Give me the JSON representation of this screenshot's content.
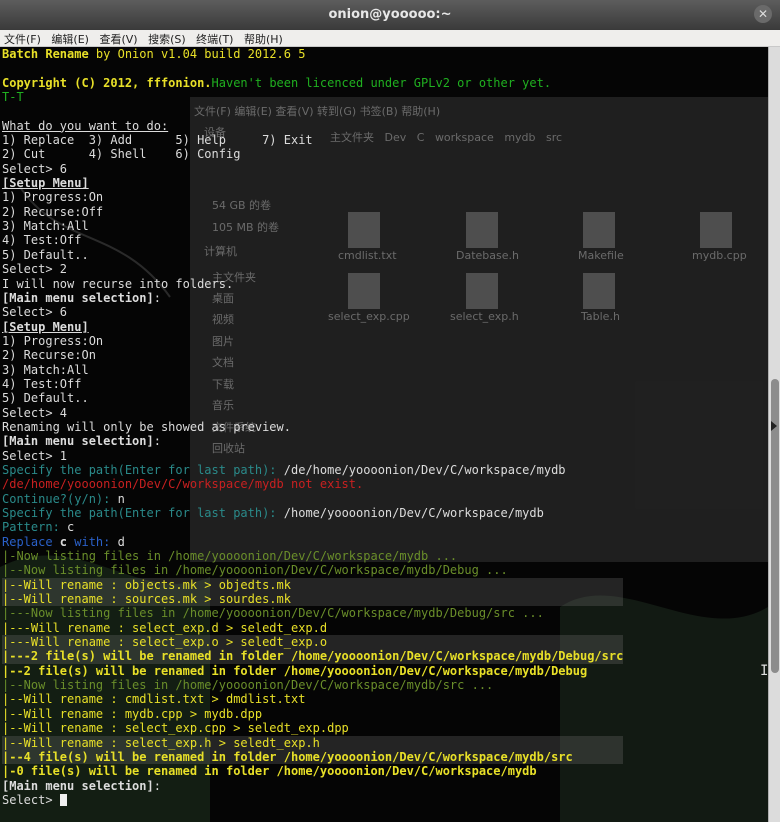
{
  "window": {
    "title": "onion@yooooo:~"
  },
  "menu": [
    "文件(F)",
    "编辑(E)",
    "查看(V)",
    "搜索(S)",
    "终端(T)",
    "帮助(H)"
  ],
  "background_window": {
    "menu": "文件(F)  编辑(E)  查看(V)  转到(G)  书签(B)  帮助(H)",
    "places": [
      "设备",
      "54 GB 的卷",
      "105 MB 的卷",
      "计算机",
      "主文件夹",
      "桌面",
      "视频",
      "图片",
      "文档",
      "下载",
      "音乐",
      "文件系统",
      "回收站"
    ],
    "breadcrumbs": [
      "主文件夹",
      "Dev",
      "C",
      "workspace",
      "mydb",
      "src"
    ],
    "files": [
      "cmdlist.txt",
      "Datebase.h",
      "Makefile",
      "mydb.cpp",
      "select_exp.cpp",
      "select_exp.h",
      "Table.h"
    ]
  },
  "terminal": {
    "lines": [
      {
        "segs": [
          {
            "t": "Batch Rename ",
            "c": "c-yellow b"
          },
          {
            "t": "by Onion v1.04 build 2012.6 5",
            "c": "c-yellow"
          }
        ]
      },
      {
        "segs": [
          {
            "t": "",
            "c": ""
          }
        ]
      },
      {
        "segs": [
          {
            "t": "Copyright (C) 2012, fffonion.",
            "c": "c-yellow b"
          },
          {
            "t": "Haven't been licenced under GPLv2 or other yet.",
            "c": "c-green"
          }
        ]
      },
      {
        "segs": [
          {
            "t": "T-T",
            "c": "c-green"
          }
        ]
      },
      {
        "segs": [
          {
            "t": "",
            "c": ""
          }
        ]
      },
      {
        "segs": [
          {
            "t": "What do you want to do:",
            "c": "c-white u"
          }
        ]
      },
      {
        "segs": [
          {
            "t": "1) Replace  3) Add      5) Help     7) Exit",
            "c": "c-white"
          }
        ]
      },
      {
        "segs": [
          {
            "t": "2) Cut      4) Shell    6) Config",
            "c": "c-white"
          }
        ]
      },
      {
        "segs": [
          {
            "t": "Select> 6",
            "c": "c-white"
          }
        ]
      },
      {
        "segs": [
          {
            "t": "[Setup Menu]",
            "c": "c-white b u"
          }
        ]
      },
      {
        "segs": [
          {
            "t": "1) Progress:On",
            "c": "c-white"
          }
        ]
      },
      {
        "segs": [
          {
            "t": "2) Recurse:Off",
            "c": "c-white"
          }
        ]
      },
      {
        "segs": [
          {
            "t": "3) Match:All",
            "c": "c-white"
          }
        ]
      },
      {
        "segs": [
          {
            "t": "4) Test:Off",
            "c": "c-white"
          }
        ]
      },
      {
        "segs": [
          {
            "t": "5) Default..",
            "c": "c-white"
          }
        ]
      },
      {
        "segs": [
          {
            "t": "Select> 2",
            "c": "c-white"
          }
        ]
      },
      {
        "segs": [
          {
            "t": "I will now recurse into folders.",
            "c": "c-white"
          }
        ]
      },
      {
        "segs": [
          {
            "t": "[Main menu selection]",
            "c": "c-white b"
          },
          {
            "t": ":",
            "c": "c-white"
          }
        ]
      },
      {
        "segs": [
          {
            "t": "Select> 6",
            "c": "c-white"
          }
        ]
      },
      {
        "segs": [
          {
            "t": "[Setup Menu]",
            "c": "c-white b u"
          }
        ]
      },
      {
        "segs": [
          {
            "t": "1) Progress:On",
            "c": "c-white"
          }
        ]
      },
      {
        "segs": [
          {
            "t": "2) Recurse:On",
            "c": "c-white"
          }
        ]
      },
      {
        "segs": [
          {
            "t": "3) Match:All",
            "c": "c-white"
          }
        ]
      },
      {
        "segs": [
          {
            "t": "4) Test:Off",
            "c": "c-white"
          }
        ]
      },
      {
        "segs": [
          {
            "t": "5) Default..",
            "c": "c-white"
          }
        ]
      },
      {
        "segs": [
          {
            "t": "Select> 4",
            "c": "c-white"
          }
        ]
      },
      {
        "segs": [
          {
            "t": "Renaming will only be showed as preview.",
            "c": "c-white"
          }
        ]
      },
      {
        "segs": [
          {
            "t": "[Main menu selection]",
            "c": "c-white b"
          },
          {
            "t": ":",
            "c": "c-white"
          }
        ]
      },
      {
        "segs": [
          {
            "t": "Select> 1",
            "c": "c-white"
          }
        ]
      },
      {
        "segs": [
          {
            "t": "Specify the path(Enter for last path):",
            "c": "c-cyan"
          },
          {
            "t": " /de/home/yoooonion/Dev/C/workspace/mydb",
            "c": "c-white"
          }
        ]
      },
      {
        "segs": [
          {
            "t": "/de/home/yoooonion/Dev/C/workspace/mydb not exist.",
            "c": "c-red"
          }
        ]
      },
      {
        "segs": [
          {
            "t": "Continue?(y/n):",
            "c": "c-cyan"
          },
          {
            "t": " n",
            "c": "c-white"
          }
        ]
      },
      {
        "segs": [
          {
            "t": "Specify the path(Enter for last path):",
            "c": "c-cyan"
          },
          {
            "t": " /home/yoooonion/Dev/C/workspace/mydb",
            "c": "c-white"
          }
        ]
      },
      {
        "segs": [
          {
            "t": "Pattern:",
            "c": "c-cyan"
          },
          {
            "t": " c",
            "c": "c-white"
          }
        ]
      },
      {
        "segs": [
          {
            "t": "Replace ",
            "c": "c-blue"
          },
          {
            "t": "c",
            "c": "c-white b"
          },
          {
            "t": " with:",
            "c": "c-blue"
          },
          {
            "t": " d",
            "c": "c-white"
          }
        ]
      },
      {
        "segs": [
          {
            "t": "|-Now listing files in /home/yoooonion/Dev/C/workspace/mydb ...",
            "c": "c-green-dim"
          }
        ]
      },
      {
        "segs": [
          {
            "t": "|--Now listing files in /home/yoooonion/Dev/C/workspace/mydb/Debug ...",
            "c": "c-green-dim"
          }
        ]
      },
      {
        "hl": true,
        "segs": [
          {
            "t": "|--Will rename : objects.mk > objedts.mk",
            "c": "c-yellow"
          }
        ]
      },
      {
        "hl": true,
        "segs": [
          {
            "t": "|--Will rename : sources.mk > sourdes.mk",
            "c": "c-yellow"
          }
        ]
      },
      {
        "segs": [
          {
            "t": "|---Now listing files in /home/yoooonion/Dev/C/workspace/mydb/Debug/src ...",
            "c": "c-green-dim"
          }
        ]
      },
      {
        "segs": [
          {
            "t": "|---Will rename : select_exp.d > seledt_exp.d",
            "c": "c-yellow"
          }
        ]
      },
      {
        "hl": true,
        "segs": [
          {
            "t": "|---Will rename : select_exp.o > seledt_exp.o",
            "c": "c-yellow"
          }
        ]
      },
      {
        "hl": true,
        "segs": [
          {
            "t": "|---2 file(s) will be renamed in folder /home/yoooonion/Dev/C/workspace/mydb/Debug/src",
            "c": "c-yellow b"
          }
        ]
      },
      {
        "segs": [
          {
            "t": "|--2 file(s) will be renamed in folder /home/yoooonion/Dev/C/workspace/mydb/Debug",
            "c": "c-yellow b"
          }
        ]
      },
      {
        "segs": [
          {
            "t": "|--Now listing files in /home/yoooonion/Dev/C/workspace/mydb/src ...",
            "c": "c-green-dim"
          }
        ]
      },
      {
        "segs": [
          {
            "t": "|--Will rename : cmdlist.txt > dmdlist.txt",
            "c": "c-yellow"
          }
        ]
      },
      {
        "segs": [
          {
            "t": "|--Will rename : mydb.cpp > mydb.dpp",
            "c": "c-yellow"
          }
        ]
      },
      {
        "segs": [
          {
            "t": "|--Will rename : select_exp.cpp > seledt_exp.dpp",
            "c": "c-yellow"
          }
        ]
      },
      {
        "hl": true,
        "segs": [
          {
            "t": "|--Will rename : select_exp.h > seledt_exp.h",
            "c": "c-yellow"
          }
        ]
      },
      {
        "hl": true,
        "segs": [
          {
            "t": "|--4 file(s) will be renamed in folder /home/yoooonion/Dev/C/workspace/mydb/src",
            "c": "c-yellow b"
          }
        ]
      },
      {
        "segs": [
          {
            "t": "|-0 file(s) will be renamed in folder /home/yoooonion/Dev/C/workspace/mydb",
            "c": "c-yellow b"
          }
        ]
      },
      {
        "segs": [
          {
            "t": "[Main menu selection]",
            "c": "c-white b"
          },
          {
            "t": ":",
            "c": "c-white"
          }
        ]
      },
      {
        "segs": [
          {
            "t": "Select> ",
            "c": "c-white"
          }
        ],
        "cursor": true
      }
    ]
  }
}
